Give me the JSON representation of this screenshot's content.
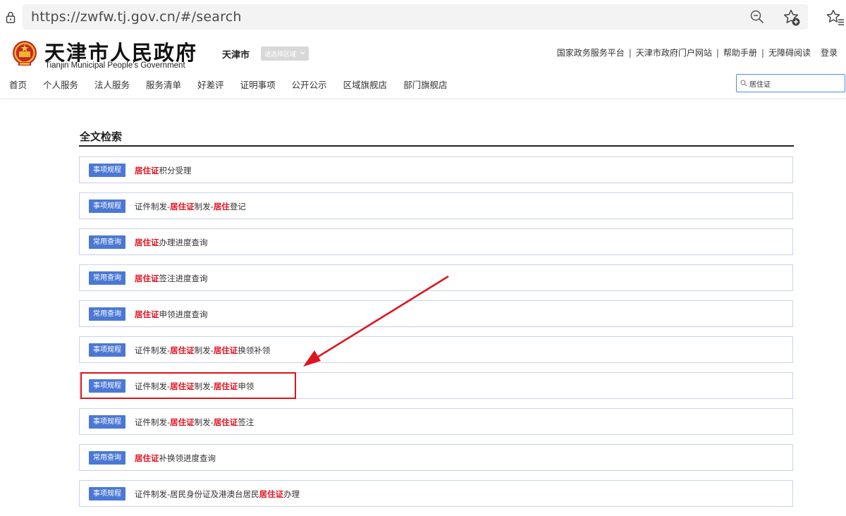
{
  "browser": {
    "url": "https://zwfw.tj.gov.cn/#/search"
  },
  "header": {
    "site_name": "天津市人民政府",
    "site_name_en": "Tianjin Municipal People's Government",
    "city": "天津市",
    "region_select": "请选择区域",
    "top_links": [
      "国家政务服务平台",
      "天津市政府门户网站",
      "帮助手册",
      "无障碍阅读"
    ],
    "login": "登录"
  },
  "nav": {
    "items": [
      "首页",
      "个人服务",
      "法人服务",
      "服务清单",
      "好差评",
      "证明事项",
      "公开公示",
      "区域旗舰店",
      "部门旗舰店"
    ]
  },
  "search": {
    "value": "居住证"
  },
  "section": {
    "title": "全文检索"
  },
  "results": [
    {
      "tag": "事项规程",
      "parts": [
        {
          "t": "居住证",
          "hl": true
        },
        {
          "t": "积分受理",
          "hl": false
        }
      ]
    },
    {
      "tag": "事项规程",
      "parts": [
        {
          "t": "证件制发-",
          "hl": false
        },
        {
          "t": "居住证",
          "hl": true
        },
        {
          "t": "制发-",
          "hl": false
        },
        {
          "t": "居住",
          "hl": true
        },
        {
          "t": "登记",
          "hl": false
        }
      ]
    },
    {
      "tag": "常用查询",
      "parts": [
        {
          "t": "居住证",
          "hl": true
        },
        {
          "t": "办理进度查询",
          "hl": false
        }
      ]
    },
    {
      "tag": "常用查询",
      "parts": [
        {
          "t": "居住证",
          "hl": true
        },
        {
          "t": "签注进度查询",
          "hl": false
        }
      ]
    },
    {
      "tag": "常用查询",
      "parts": [
        {
          "t": "居住证",
          "hl": true
        },
        {
          "t": "申领进度查询",
          "hl": false
        }
      ]
    },
    {
      "tag": "事项规程",
      "parts": [
        {
          "t": "证件制发-",
          "hl": false
        },
        {
          "t": "居住证",
          "hl": true
        },
        {
          "t": "制发-",
          "hl": false
        },
        {
          "t": "居住证",
          "hl": true
        },
        {
          "t": "换领补领",
          "hl": false
        }
      ]
    },
    {
      "tag": "事项规程",
      "parts": [
        {
          "t": "证件制发-",
          "hl": false
        },
        {
          "t": "居住证",
          "hl": true
        },
        {
          "t": "制发-",
          "hl": false
        },
        {
          "t": "居住证",
          "hl": true
        },
        {
          "t": "申领",
          "hl": false
        }
      ]
    },
    {
      "tag": "事项规程",
      "parts": [
        {
          "t": "证件制发-",
          "hl": false
        },
        {
          "t": "居住证",
          "hl": true
        },
        {
          "t": "制发-",
          "hl": false
        },
        {
          "t": "居住证",
          "hl": true
        },
        {
          "t": "签注",
          "hl": false
        }
      ]
    },
    {
      "tag": "常用查询",
      "parts": [
        {
          "t": "居住证",
          "hl": true
        },
        {
          "t": "补换领进度查询",
          "hl": false
        }
      ]
    },
    {
      "tag": "事项规程",
      "parts": [
        {
          "t": "证件制发-居民身份证及港澳台居民",
          "hl": false
        },
        {
          "t": "居住证",
          "hl": true
        },
        {
          "t": "办理",
          "hl": false
        }
      ]
    }
  ],
  "colors": {
    "accent": "#4b78d4",
    "highlight_text": "#e3101d",
    "annotation": "#d9141d"
  }
}
